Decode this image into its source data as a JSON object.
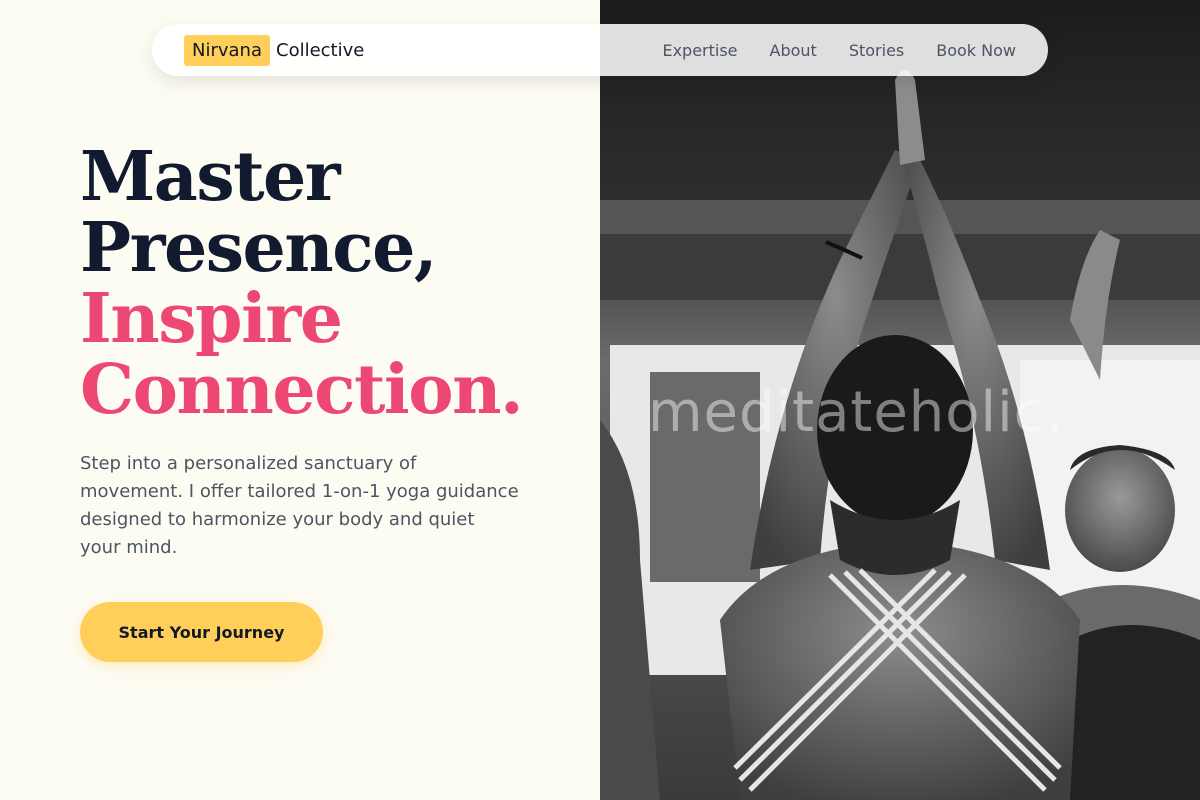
{
  "nav": {
    "logo_mark": "Nirvana",
    "logo_rest": "Collective",
    "links": [
      "Expertise",
      "About",
      "Stories",
      "Book Now"
    ]
  },
  "hero": {
    "line1": "Master",
    "line2": "Presence,",
    "line3": "Inspire",
    "line4": "Connection.",
    "description": "Step into a personalized sanctuary of movement. I offer tailored 1-on-1 yoga guidance designed to harmonize your body and quiet your mind.",
    "cta_label": "Start Your Journey"
  },
  "image": {
    "watermark": "meditateholic."
  },
  "colors": {
    "accent_yellow": "#ffcf5a",
    "accent_pink": "#ec4873",
    "heading_dark": "#111a2e",
    "background": "#fdfcf3"
  }
}
